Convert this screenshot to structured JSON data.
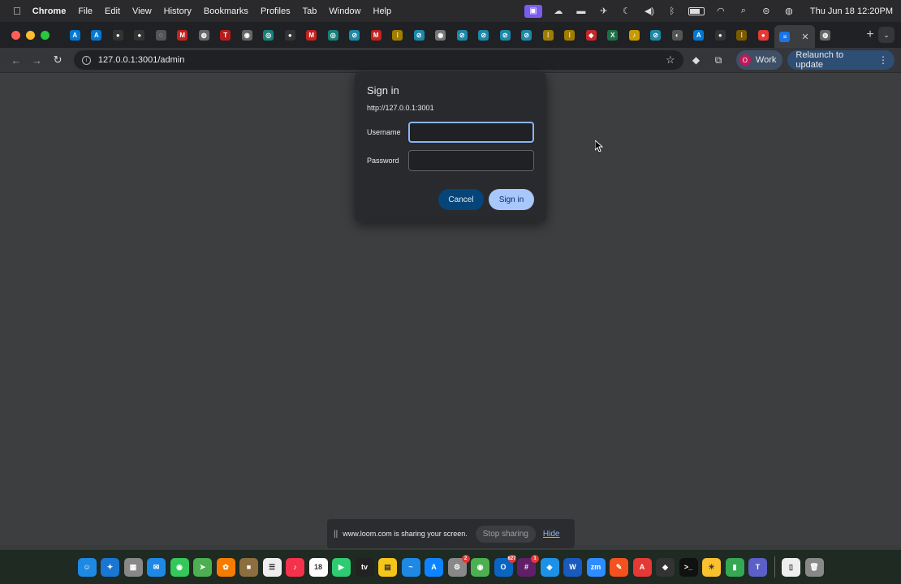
{
  "menubar": {
    "app_name": "Chrome",
    "menus": [
      "File",
      "Edit",
      "View",
      "History",
      "Bookmarks",
      "Profiles",
      "Tab",
      "Window",
      "Help"
    ],
    "clock": "Thu Jun 18  12:20PM"
  },
  "tabs": [
    {
      "icon": "azure-icon",
      "glyph": "A",
      "color": "#0078d4"
    },
    {
      "icon": "azure-icon",
      "glyph": "A",
      "color": "#0078d4"
    },
    {
      "icon": "github-icon",
      "glyph": "●",
      "color": "#333"
    },
    {
      "icon": "github-icon",
      "glyph": "●",
      "color": "#333"
    },
    {
      "icon": "loading-icon",
      "glyph": "◌",
      "color": "#555"
    },
    {
      "icon": "gmail-icon",
      "glyph": "M",
      "color": "#c5221f"
    },
    {
      "icon": "globe-icon",
      "glyph": "◍",
      "color": "#666"
    },
    {
      "icon": "tesla-icon",
      "glyph": "T",
      "color": "#b71c1c"
    },
    {
      "icon": "settings-icon",
      "glyph": "◉",
      "color": "#666"
    },
    {
      "icon": "copilot-icon",
      "glyph": "◎",
      "color": "#1a7f7a"
    },
    {
      "icon": "github-icon",
      "glyph": "●",
      "color": "#333"
    },
    {
      "icon": "gmail-icon",
      "glyph": "M",
      "color": "#c5221f"
    },
    {
      "icon": "copilot-icon",
      "glyph": "◎",
      "color": "#1a7f7a"
    },
    {
      "icon": "compass-icon",
      "glyph": "⊘",
      "color": "#1e88a8"
    },
    {
      "icon": "gmail-icon",
      "glyph": "M",
      "color": "#c5221f"
    },
    {
      "icon": "databricks-icon",
      "glyph": "⁞",
      "color": "#a07d00"
    },
    {
      "icon": "compass-icon",
      "glyph": "⊘",
      "color": "#1e88a8"
    },
    {
      "icon": "chrome-icon",
      "glyph": "◉",
      "color": "#777"
    },
    {
      "icon": "compass-icon",
      "glyph": "⊘",
      "color": "#1e88a8"
    },
    {
      "icon": "compass-icon",
      "glyph": "⊘",
      "color": "#1e88a8"
    },
    {
      "icon": "compass-icon",
      "glyph": "⊘",
      "color": "#1e88a8"
    },
    {
      "icon": "compass-icon",
      "glyph": "⊘",
      "color": "#1e88a8"
    },
    {
      "icon": "databricks-icon",
      "glyph": "⁞",
      "color": "#a07d00"
    },
    {
      "icon": "databricks-icon",
      "glyph": "⁞",
      "color": "#a07d00"
    },
    {
      "icon": "diamond-icon",
      "glyph": "◆",
      "color": "#c62828"
    },
    {
      "icon": "excel-icon",
      "glyph": "X",
      "color": "#1e7145"
    },
    {
      "icon": "bell-icon",
      "glyph": "♪",
      "color": "#c89b00"
    },
    {
      "icon": "compass-icon",
      "glyph": "⊘",
      "color": "#1e88a8"
    },
    {
      "icon": "openai-icon",
      "glyph": "◐",
      "color": "#555"
    },
    {
      "icon": "azure-icon",
      "glyph": "A",
      "color": "#0078d4"
    },
    {
      "icon": "github-icon",
      "glyph": "●",
      "color": "#333"
    },
    {
      "icon": "grid-icon",
      "glyph": "⁞",
      "color": "#7a5b00"
    },
    {
      "icon": "record-icon",
      "glyph": "●",
      "color": "#e53935"
    }
  ],
  "active_tab": {
    "icon": "docs-icon",
    "glyph": "≡",
    "color": "#1a73e8"
  },
  "toolbar": {
    "url": "127.0.0.1:3001/admin",
    "profile_initial": "O",
    "profile_label": "Work",
    "relaunch_label": "Relaunch to update"
  },
  "dialog": {
    "title": "Sign in",
    "origin": "http://127.0.0.1:3001",
    "username_label": "Username",
    "username_value": "",
    "password_label": "Password",
    "password_value": "",
    "cancel_label": "Cancel",
    "signin_label": "Sign in"
  },
  "loom": {
    "message": "www.loom.com is sharing your screen.",
    "stop_label": "Stop sharing",
    "hide_label": "Hide"
  },
  "dock": [
    {
      "icon": "finder-icon",
      "glyph": "☺",
      "color": "#1e88e5"
    },
    {
      "icon": "safari-icon",
      "glyph": "✦",
      "color": "#1976d2"
    },
    {
      "icon": "launchpad-icon",
      "glyph": "▦",
      "color": "#888"
    },
    {
      "icon": "mail-icon",
      "glyph": "✉",
      "color": "#1e88e5"
    },
    {
      "icon": "messages-icon",
      "glyph": "◉",
      "color": "#34c759"
    },
    {
      "icon": "maps-icon",
      "glyph": "➤",
      "color": "#4caf50"
    },
    {
      "icon": "photos-icon",
      "glyph": "✿",
      "color": "#f57c00"
    },
    {
      "icon": "notes-brown-icon",
      "glyph": "■",
      "color": "#8d6e3f"
    },
    {
      "icon": "reminders-icon",
      "glyph": "☰",
      "color": "#eee"
    },
    {
      "icon": "music-icon",
      "glyph": "♪",
      "color": "#f5314b"
    },
    {
      "icon": "calendar-icon",
      "glyph": "18",
      "color": "#fff"
    },
    {
      "icon": "facetime-icon",
      "glyph": "▶",
      "color": "#2ecc71"
    },
    {
      "icon": "tv-icon",
      "glyph": "tv",
      "color": "#222"
    },
    {
      "icon": "notes-icon",
      "glyph": "▤",
      "color": "#f5c518"
    },
    {
      "icon": "freeform-icon",
      "glyph": "~",
      "color": "#1e88e5"
    },
    {
      "icon": "app-store-icon",
      "glyph": "A",
      "color": "#0d84ff"
    },
    {
      "icon": "system-settings-icon",
      "glyph": "⚙",
      "color": "#888",
      "badge": "2"
    },
    {
      "icon": "chrome-icon",
      "glyph": "◉",
      "color": "#4caf50"
    },
    {
      "icon": "outlook-icon",
      "glyph": "O",
      "color": "#0a64c2",
      "badge": "627"
    },
    {
      "icon": "slack-icon",
      "glyph": "#",
      "color": "#611f69",
      "badge": "1"
    },
    {
      "icon": "docker-icon",
      "glyph": "◈",
      "color": "#1d91e6"
    },
    {
      "icon": "word-icon",
      "glyph": "W",
      "color": "#185abd"
    },
    {
      "icon": "zoom-icon",
      "glyph": "zm",
      "color": "#2d8cff"
    },
    {
      "icon": "pen-icon",
      "glyph": "✎",
      "color": "#f4511e"
    },
    {
      "icon": "acrobat-icon",
      "glyph": "A",
      "color": "#e53935"
    },
    {
      "icon": "cube-icon",
      "glyph": "◆",
      "color": "#333"
    },
    {
      "icon": "terminal-icon",
      "glyph": ">_",
      "color": "#111"
    },
    {
      "icon": "weather-icon",
      "glyph": "☀",
      "color": "#fbc02d"
    },
    {
      "icon": "numbers-icon",
      "glyph": "▮",
      "color": "#34a853"
    },
    {
      "icon": "teams-icon",
      "glyph": "T",
      "color": "#5b5fc7"
    },
    {
      "icon": "document-icon",
      "glyph": "▯",
      "color": "#eee"
    },
    {
      "icon": "trash-icon",
      "glyph": "🗑",
      "color": "#888"
    }
  ]
}
